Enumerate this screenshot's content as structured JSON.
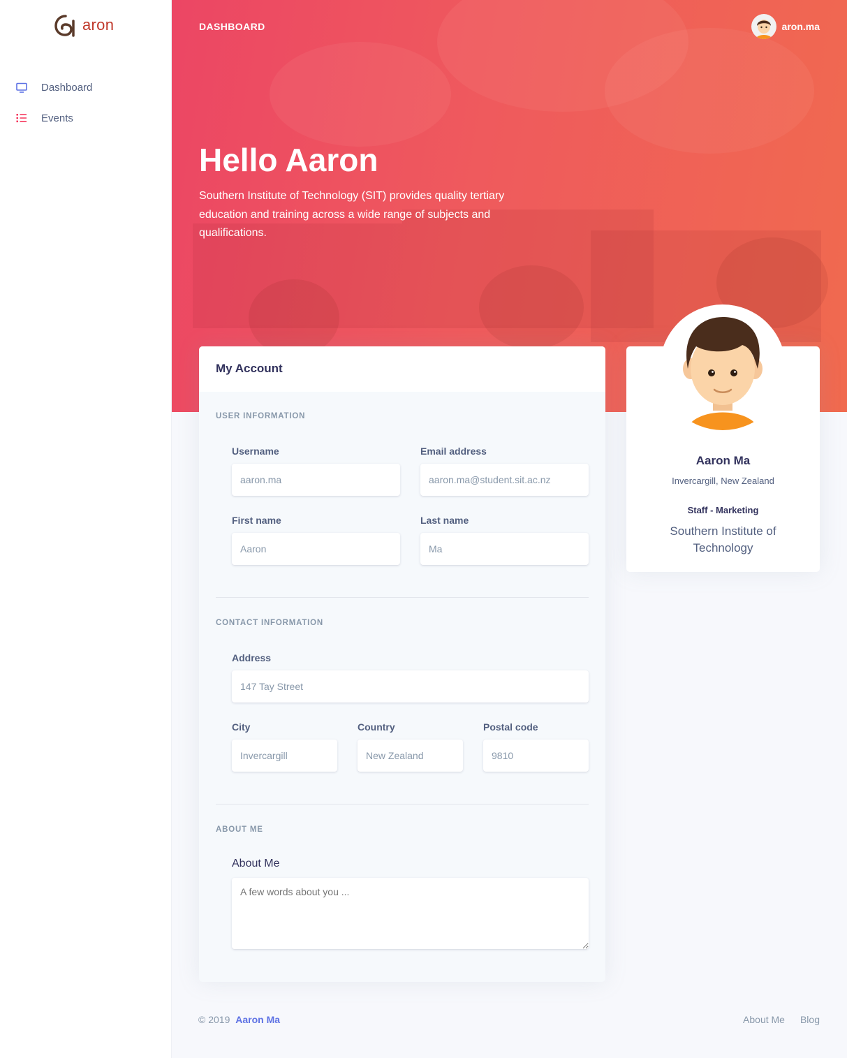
{
  "brand": {
    "name": "aron"
  },
  "sidebar": {
    "items": [
      {
        "label": "Dashboard",
        "icon": "monitor-icon",
        "color": "#5e72e4"
      },
      {
        "label": "Events",
        "icon": "list-icon",
        "color": "#f5365c"
      }
    ]
  },
  "topbar": {
    "title": "DASHBOARD",
    "username": "aron.ma"
  },
  "hero": {
    "title": "Hello Aaron",
    "text": "Southern Institute of Technology (SIT) provides quality tertiary education and training across a wide range of subjects and qualifications."
  },
  "account": {
    "title": "My Account",
    "user_section": "USER INFORMATION",
    "username_label": "Username",
    "username_value": "aaron.ma",
    "email_label": "Email address",
    "email_value": "aaron.ma@student.sit.ac.nz",
    "firstname_label": "First name",
    "firstname_value": "Aaron",
    "lastname_label": "Last name",
    "lastname_value": "Ma",
    "contact_section": "CONTACT INFORMATION",
    "address_label": "Address",
    "address_value": "147 Tay Street",
    "city_label": "City",
    "city_value": "Invercargill",
    "country_label": "Country",
    "country_value": "New Zealand",
    "postal_label": "Postal code",
    "postal_value": "9810",
    "about_section": "ABOUT ME",
    "about_label": "About Me",
    "about_placeholder": "A few words about you ..."
  },
  "profile": {
    "name": "Aaron Ma",
    "location": "Invercargill, New Zealand",
    "role": "Staff - Marketing",
    "organization": "Southern Institute of Technology"
  },
  "footer": {
    "copyright": "© 2019",
    "author": "Aaron Ma",
    "links": [
      "About Me",
      "Blog"
    ]
  },
  "colors": {
    "accent": "#5e72e4",
    "hero_start": "#ec4664",
    "hero_end": "#f06a4f",
    "brand": "#c0392b"
  }
}
